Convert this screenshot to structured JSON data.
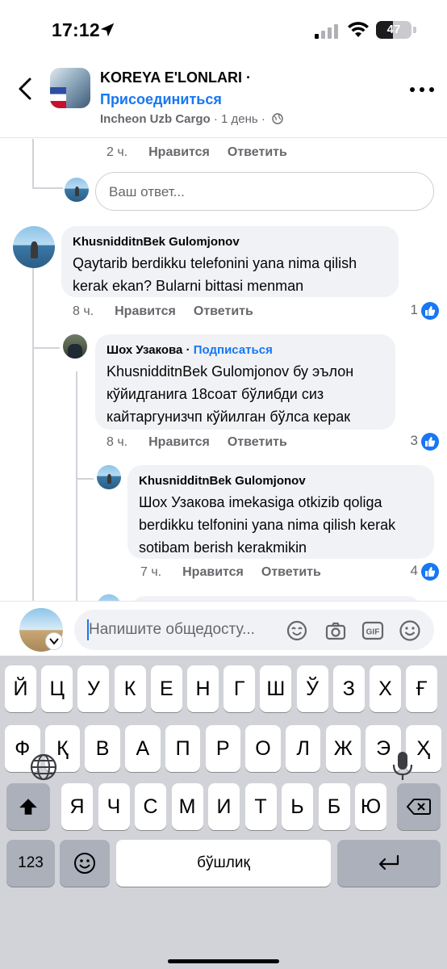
{
  "status_bar": {
    "time": "17:12",
    "battery": "47",
    "battery_level": 0.47
  },
  "header": {
    "group_name": "KOREYA E'LONLARI ·",
    "join_label": "Присоединиться",
    "author": "Incheon Uzb Cargo",
    "time": "· 1 день ·"
  },
  "prev_comment_meta": {
    "time": "2 ч.",
    "like": "Нравится",
    "reply": "Ответить"
  },
  "reply_input": {
    "placeholder": "Ваш ответ..."
  },
  "comments": [
    {
      "author": "KhusnidditnBek Gulomjonov",
      "text": "Qaytarib berdikku telefonini yana nima qilish kerak ekan? Bularni bittasi menman",
      "time": "8 ч.",
      "like": "Нравится",
      "reply": "Ответить",
      "reactions": "1"
    },
    {
      "author": "Шох Узакова",
      "follow": "Подписаться",
      "text": "KhusnidditnBek Gulomjonov бу эълон кўйидганига 18соат бўлибди сиз кайтаргунизчп кўйилган бўлса керак",
      "time": "8 ч.",
      "like": "Нравится",
      "reply": "Ответить",
      "reactions": "3"
    },
    {
      "author": "KhusnidditnBek Gulomjonov",
      "text": "Шох Узакова imekasiga otkizib qoliga berdikku telfonini yana nima qilish kerak sotibam berish kerakmikin",
      "time": "7 ч.",
      "like": "Нравится",
      "reply": "Ответить",
      "reactions": "4"
    }
  ],
  "composer": {
    "placeholder": "Напишите общедосту..."
  },
  "keyboard": {
    "row1": [
      "Й",
      "Ц",
      "У",
      "К",
      "Е",
      "Н",
      "Г",
      "Ш",
      "Ў",
      "З",
      "Х",
      "Ғ"
    ],
    "row2": [
      "Ф",
      "Қ",
      "В",
      "А",
      "П",
      "Р",
      "О",
      "Л",
      "Ж",
      "Э",
      "Ҳ"
    ],
    "row3": [
      "Я",
      "Ч",
      "С",
      "М",
      "И",
      "Т",
      "Ь",
      "Б",
      "Ю"
    ],
    "numbers_key": "123",
    "space_label": "бўшлиқ"
  }
}
